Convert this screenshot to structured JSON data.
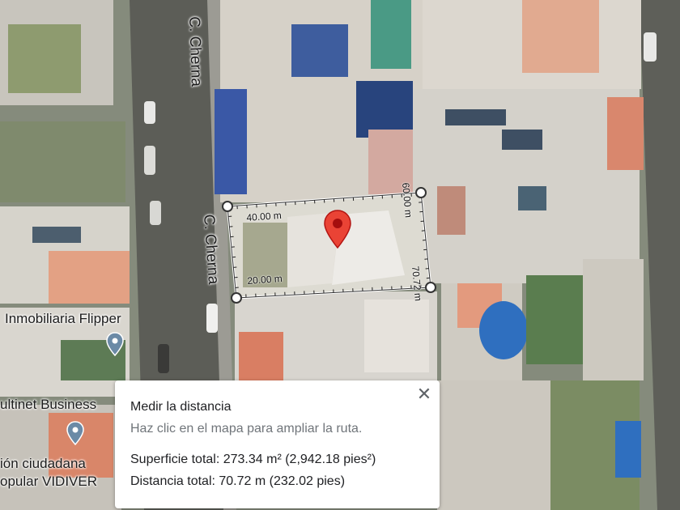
{
  "streets": {
    "top": "C. Cherna",
    "middle": "C. Cherna"
  },
  "pois": [
    {
      "label": "Inmobiliaria Flipper",
      "icon": "location-pin-icon"
    },
    {
      "label": "ultinet Business",
      "icon": "location-pin-icon"
    },
    {
      "label": "ión ciudadana",
      "icon": ""
    },
    {
      "label": "opular VIDIVER",
      "icon": ""
    }
  ],
  "measurement": {
    "segments": [
      "40.00 m",
      "60.00 m",
      "70.72 m",
      "20.00 m"
    ],
    "color_line": "#ffffff",
    "color_vertex": "#333333"
  },
  "marker": {
    "icon": "red-map-pin-icon",
    "color": "#ea4335"
  },
  "panel": {
    "title": "Medir la distancia",
    "hint": "Haz clic en el mapa para ampliar la ruta.",
    "area": "Superficie total: 273.34 m² (2,942.18 pies²)",
    "distance": "Distancia total: 70.72 m (232.02 pies)",
    "close_icon": "close-icon"
  }
}
